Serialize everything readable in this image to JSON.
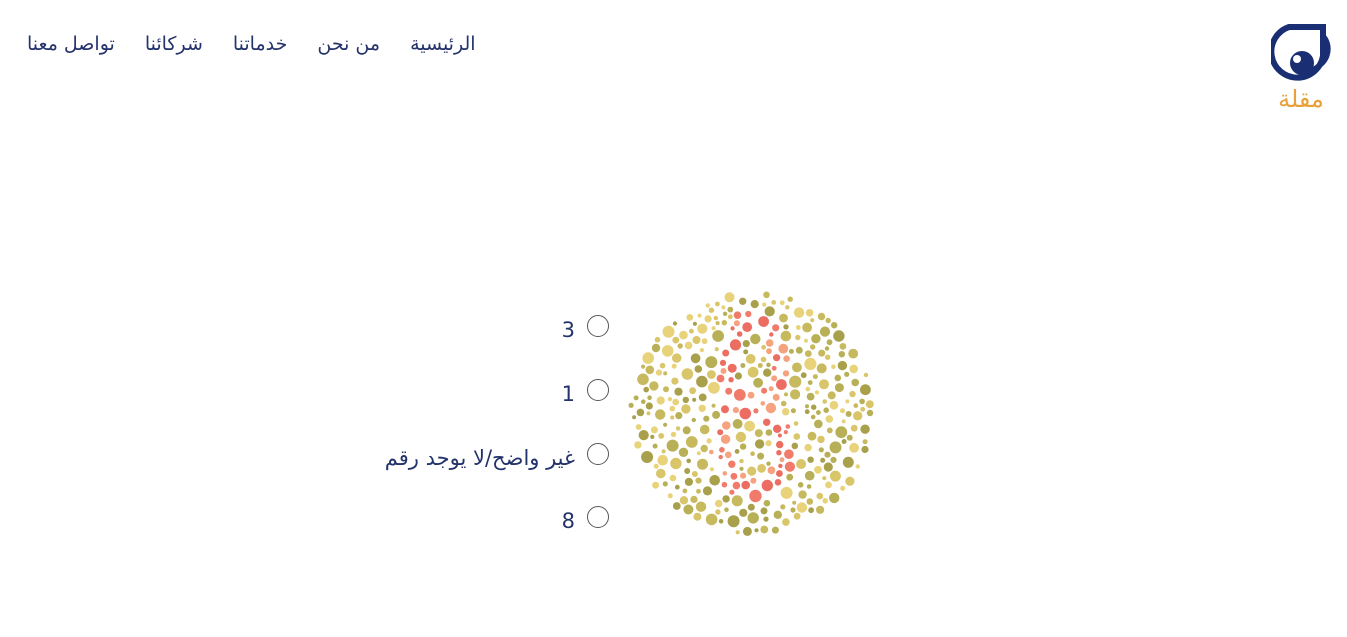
{
  "logo": {
    "wordmark": "مقلة",
    "colors": {
      "ring": "#1a2e73",
      "wordmark": "#e8a13a"
    }
  },
  "nav": {
    "items": [
      {
        "label": "الرئيسية"
      },
      {
        "label": "من نحن"
      },
      {
        "label": "خدماتنا"
      },
      {
        "label": "شركائنا"
      },
      {
        "label": "تواصل معنا"
      }
    ]
  },
  "test": {
    "plate_digit_shown": "8",
    "options": [
      {
        "label": "3"
      },
      {
        "label": "1"
      },
      {
        "label": "غير واضح/لا يوجد رقم"
      },
      {
        "label": "8"
      }
    ]
  },
  "colors": {
    "text": "#24336b",
    "figure": [
      "#f07b6b",
      "#f5a27f",
      "#ec6e63"
    ],
    "background_dots": [
      "#b8b056",
      "#d9c56a",
      "#e8d27a",
      "#a9a04c",
      "#c7b95d"
    ]
  }
}
